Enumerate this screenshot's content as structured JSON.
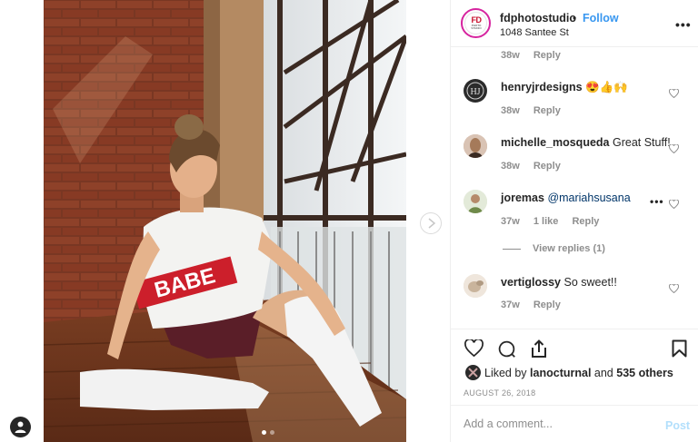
{
  "post": {
    "username": "fdphotostudio",
    "bullet": "•",
    "follow_label": "Follow",
    "location": "1048 Santee St",
    "more_icon": "more-horizontal-icon",
    "avatar_logo": "FD",
    "avatar_logo_sub": "PHOTO STUDIO",
    "shirt_text": "BABE"
  },
  "comments": {
    "top_meta": {
      "time": "38w",
      "reply": "Reply"
    },
    "items": [
      {
        "user": "henryjrdesigns",
        "text": "😍👍🙌",
        "time": "38w",
        "reply": "Reply"
      },
      {
        "user": "michelle_mosqueda",
        "text": "Great Stuff!",
        "time": "38w",
        "reply": "Reply"
      },
      {
        "user": "joremas",
        "mention": "@mariahsusana",
        "time": "37w",
        "likes": "1 like",
        "reply": "Reply"
      },
      {
        "user": "vertiglossy",
        "text": "So sweet!!",
        "time": "37w",
        "reply": "Reply"
      }
    ],
    "view_replies": "View replies (1)",
    "ellipsis": "•••"
  },
  "likes": {
    "prefix": "Liked by",
    "user": "lanocturnal",
    "and": "and",
    "others": "535 others"
  },
  "date": "AUGUST 26, 2018",
  "add_comment": {
    "placeholder": "Add a comment...",
    "post_label": "Post"
  },
  "carousel": {
    "active_index": 0,
    "count": 2
  },
  "colors": {
    "follow": "#3897f0",
    "post_disabled": "#b2dffc",
    "muted": "#8e8e8e",
    "text": "#262626"
  }
}
